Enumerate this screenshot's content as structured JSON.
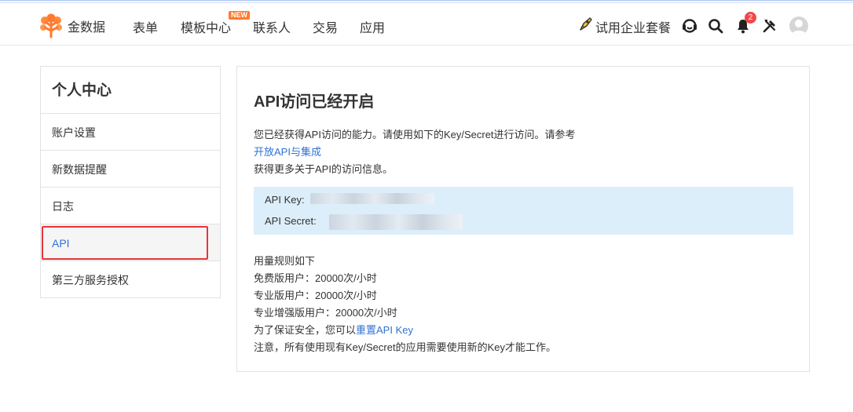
{
  "brand": {
    "name": "金数据"
  },
  "nav": {
    "items": [
      "表单",
      "模板中心",
      "联系人",
      "交易",
      "应用"
    ],
    "new_badge": "NEW"
  },
  "header": {
    "trial_label": "试用企业套餐",
    "notification_count": "2",
    "icons": [
      "rocket-icon",
      "support-headset-icon",
      "search-icon",
      "bell-icon",
      "tools-icon",
      "avatar"
    ]
  },
  "sidebar": {
    "title": "个人中心",
    "items": [
      {
        "label": "账户设置"
      },
      {
        "label": "新数据提醒"
      },
      {
        "label": "日志"
      },
      {
        "label": "API"
      },
      {
        "label": "第三方服务授权"
      }
    ],
    "active_index": 3
  },
  "main": {
    "title": "API访问已经开启",
    "intro_line1": "您已经获得API访问的能力。请使用如下的Key/Secret进行访问。请参考",
    "intro_link": "开放API与集成",
    "intro_line3": "获得更多关于API的访问信息。",
    "key_label": "API Key:",
    "secret_label": "API Secret:",
    "usage_title": "用量规则如下",
    "usage_free": "免费版用户：20000次/小时",
    "usage_pro": "专业版用户：20000次/小时",
    "usage_pro_plus": "专业增强版用户：20000次/小时",
    "reset_prefix": "为了保证安全，您可以",
    "reset_link": "重置API Key",
    "notice": "注意，所有使用现有Key/Secret的应用需要使用新的Key才能工作。"
  },
  "colors": {
    "accent": "#2f72d4",
    "brand_orange": "#ff7a2f",
    "key_box_bg": "#ddeefb",
    "highlight_red": "#e8343a",
    "badge_red": "#f04848"
  }
}
